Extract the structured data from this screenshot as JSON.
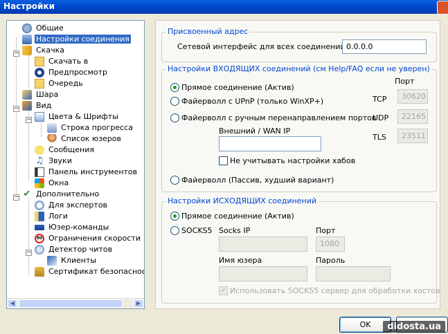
{
  "window": {
    "title": "Настройки"
  },
  "tree": {
    "items": [
      {
        "label": "Общие",
        "icon": "settings-icon"
      },
      {
        "label": "Настройки соединения",
        "icon": "network-icon",
        "selected": true
      },
      {
        "label": "Скачка",
        "icon": "download-icon"
      },
      {
        "label": "Скачать в",
        "icon": "folder-icon"
      },
      {
        "label": "Предпросмотр",
        "icon": "preview-icon"
      },
      {
        "label": "Очередь",
        "icon": "queue-icon"
      },
      {
        "label": "Шара",
        "icon": "share-icon"
      },
      {
        "label": "Вид",
        "icon": "view-icon"
      },
      {
        "label": "Цвета & Шрифты",
        "icon": "palette-icon"
      },
      {
        "label": "Строка прогресса",
        "icon": "progress-icon"
      },
      {
        "label": "Список юзеров",
        "icon": "users-icon"
      },
      {
        "label": "Сообщения",
        "icon": "message-icon"
      },
      {
        "label": "Звуки",
        "icon": "sound-icon"
      },
      {
        "label": "Панель инструментов",
        "icon": "toolbar-icon"
      },
      {
        "label": "Окна",
        "icon": "windows-icon"
      },
      {
        "label": "Дополнительно",
        "icon": "advanced-icon"
      },
      {
        "label": "Для экспертов",
        "icon": "expert-icon"
      },
      {
        "label": "Логи",
        "icon": "log-icon"
      },
      {
        "label": "Юзер-команды",
        "icon": "command-icon"
      },
      {
        "label": "Ограничения скорости",
        "icon": "speed-limit-icon"
      },
      {
        "label": "Детектор читов",
        "icon": "detector-icon"
      },
      {
        "label": "Клиенты",
        "icon": "client-icon"
      },
      {
        "label": "Сертификат безопасности",
        "icon": "certificate-icon"
      }
    ]
  },
  "assigned": {
    "legend": "Присвоенный адрес",
    "label": "Сетевой интерфейс для всех соединений",
    "value": "0.0.0.0"
  },
  "incoming": {
    "legend": "Настройки ВХОДЯЩИХ соединений (см Help/FAQ если не уверен)",
    "port_header": "Порт",
    "direct": "Прямое соединение (Актив)",
    "upnp": "Файерволл с UPnP (только WinXP+)",
    "manual": "Файерволл с ручным перенаправлением портов",
    "passive": "Файерволл (Пассив, худший вариант)",
    "wan_label": "Внешний / WAN IP",
    "wan_value": "",
    "ignore_hubs": "Не учитывать настройки хабов",
    "tcp_label": "TCP",
    "tcp_value": "30620",
    "udp_label": "UDP",
    "udp_value": "22165",
    "tls_label": "TLS",
    "tls_value": "23511"
  },
  "outgoing": {
    "legend": "Настройки ИСХОДЯЩИХ соединений",
    "direct": "Прямое соединение (Актив)",
    "socks5": "SOCKS5",
    "socks_ip_label": "Socks IP",
    "socks_ip_value": "",
    "port_label": "Порт",
    "port_value": "1080",
    "user_label": "Имя юзера",
    "user_value": "",
    "pass_label": "Пароль",
    "pass_value": "",
    "use_socks": "Использовать SOCKS5 сервер для обработки хостов"
  },
  "buttons": {
    "ok": "OK"
  },
  "watermark": "didosta.ua"
}
